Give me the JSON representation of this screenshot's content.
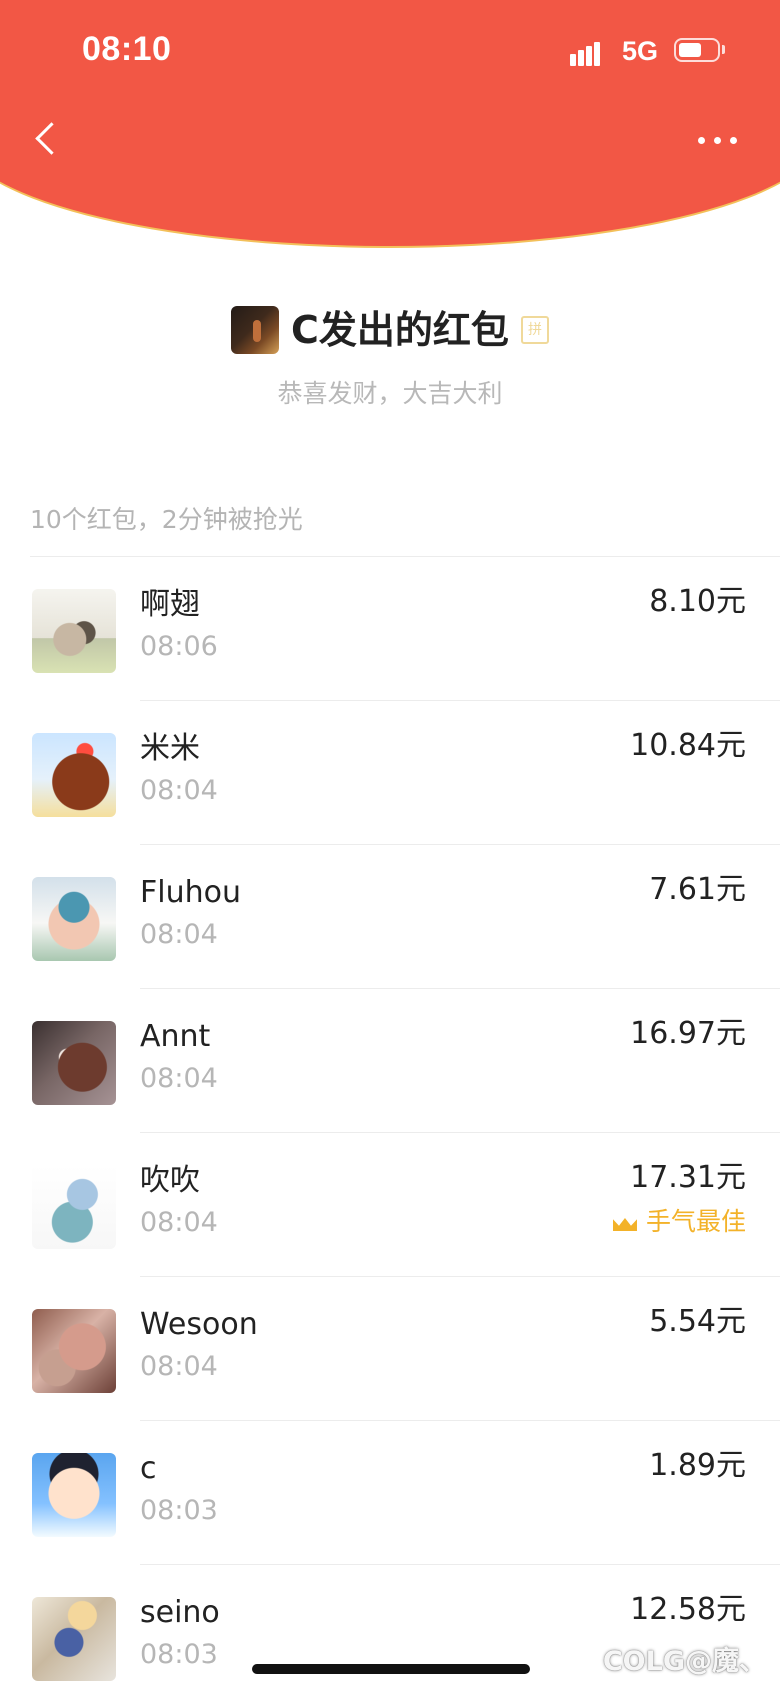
{
  "status_bar": {
    "time": "08:10",
    "network": "5G",
    "icons": [
      "signal-icon",
      "battery-icon"
    ]
  },
  "navigation": {
    "icons": [
      "back-icon",
      "more-icon"
    ]
  },
  "header": {
    "sender_title": "C发出的红包",
    "pin_tag": "拼",
    "greeting": "恭喜发财，大吉大利",
    "colors": {
      "header_red": "#f25745",
      "accent_gold": "#f3b229"
    }
  },
  "summary": "10个红包，2分钟被抢光",
  "recipients": [
    {
      "name": "啊翅",
      "time": "08:06",
      "amount": "8.10元"
    },
    {
      "name": "米米",
      "time": "08:04",
      "amount": "10.84元"
    },
    {
      "name": "Fluhou",
      "time": "08:04",
      "amount": "7.61元"
    },
    {
      "name": "Annt",
      "time": "08:04",
      "amount": "16.97元"
    },
    {
      "name": "吹吹",
      "time": "08:04",
      "amount": "17.31元",
      "best_luck": "手气最佳"
    },
    {
      "name": "Wesoon",
      "time": "08:04",
      "amount": "5.54元"
    },
    {
      "name": "c",
      "time": "08:03",
      "amount": "1.89元"
    },
    {
      "name": "seino",
      "time": "08:03",
      "amount": "12.58元"
    }
  ],
  "watermark": "COLG@魔、"
}
